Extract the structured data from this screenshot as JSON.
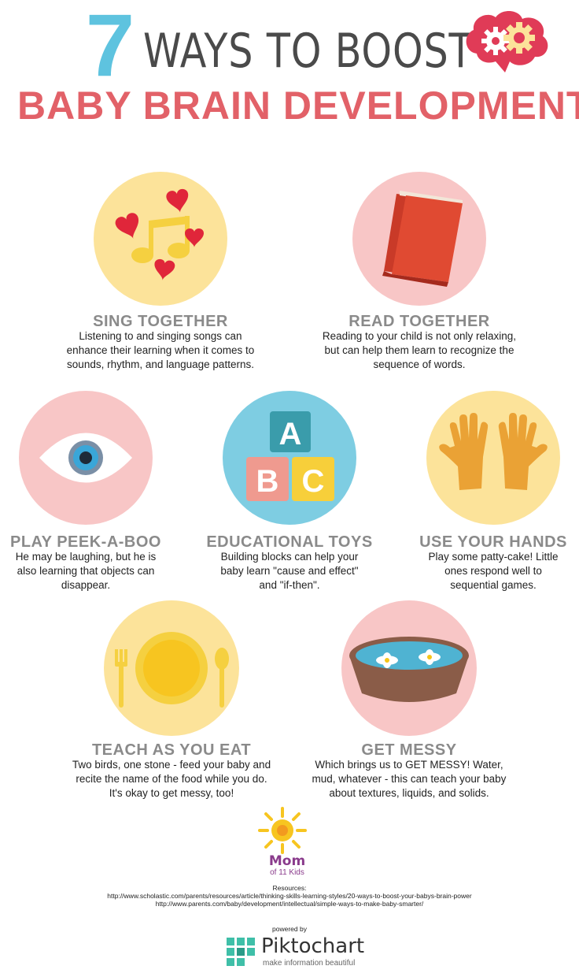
{
  "header": {
    "number": "7",
    "title_line1": "WAYS TO BOOST",
    "title_line2": "BABY BRAIN DEVELOPMENT"
  },
  "colors": {
    "yellow": "#fce39a",
    "pink": "#f8c6c6",
    "blue": "#7ecde2",
    "title_red": "#e26168",
    "accent_blue": "#5ec3df",
    "heading_gray": "#8a8a8a"
  },
  "tips": [
    {
      "icon": "music-hearts-icon",
      "title": "SING TOGETHER",
      "lines": [
        "Listening to and singing songs can",
        "enhance their learning when it comes to",
        "sounds, rhythm, and language patterns."
      ]
    },
    {
      "icon": "book-icon",
      "title": "READ TOGETHER",
      "lines": [
        "Reading to your child is not only relaxing,",
        "but can help them learn to recognize the",
        "sequence of words."
      ]
    },
    {
      "icon": "eye-icon",
      "title": "PLAY PEEK-A-BOO",
      "lines": [
        "He may be laughing, but he is",
        "also learning that objects can",
        "disappear."
      ]
    },
    {
      "icon": "abc-blocks-icon",
      "title": "EDUCATIONAL TOYS",
      "lines": [
        "Building blocks can help your",
        "baby learn \"cause and effect\"",
        "and \"if-then\"."
      ]
    },
    {
      "icon": "gloves-icon",
      "title": "USE YOUR HANDS",
      "lines": [
        "Play some patty-cake! Little",
        "ones respond well to",
        "sequential games."
      ]
    },
    {
      "icon": "plate-cutlery-icon",
      "title": "TEACH AS YOU EAT",
      "lines": [
        "Two birds, one stone - feed your baby and",
        "recite the name of the food while you do.",
        "It's okay to get messy, too!"
      ]
    },
    {
      "icon": "water-bowl-icon",
      "title": "GET MESSY",
      "lines": [
        "Which brings us to GET MESSY! Water,",
        "mud, whatever - this can teach your baby",
        "about textures, liquids, and solids."
      ]
    }
  ],
  "blocks": {
    "a": "A",
    "b": "B",
    "c": "C"
  },
  "brand": {
    "name": "Mom",
    "sub": "of 11 Kids"
  },
  "resources": {
    "label": "Resources:",
    "links": [
      "http://www.scholastic.com/parents/resources/article/thinking-skills-learning-styles/20-ways-to-boost-your-babys-brain-power",
      "http://www.parents.com/baby/development/intellectual/simple-ways-to-make-baby-smarter/"
    ]
  },
  "footer": {
    "powered_by": "powered by",
    "piktochart": "Piktochart",
    "tagline": "make information beautiful"
  }
}
